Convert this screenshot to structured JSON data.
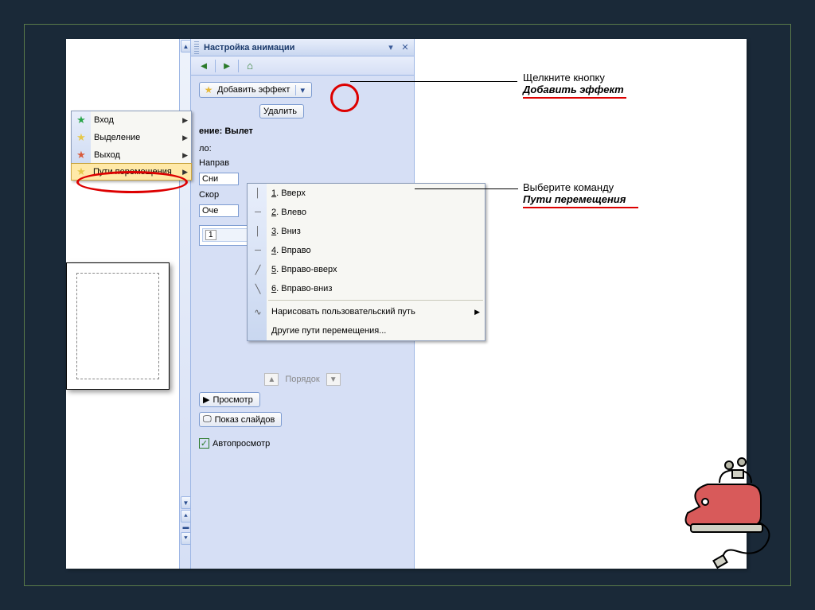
{
  "pane": {
    "title": "Настройка анимации",
    "add_effect": "Добавить эффект",
    "remove": "Удалить",
    "change_label": "ение: Вылет",
    "start_label": "ло:",
    "direction_label": "Направ",
    "direction_value": "Сни",
    "speed_label": "Скор",
    "speed_value": "Оче",
    "item_num": "1",
    "order": "Порядок",
    "preview": "Просмотр",
    "slideshow": "Показ слайдов",
    "autoshow": "Автопросмотр"
  },
  "menu1": {
    "items": [
      {
        "label": "Вход",
        "star_color": "#2aa54a"
      },
      {
        "label": "Выделение",
        "star_color": "#e6c84a"
      },
      {
        "label": "Выход",
        "star_color": "#d85a3a"
      },
      {
        "label": "Пути перемещения",
        "star_color": "#e6c84a",
        "selected": true
      }
    ]
  },
  "menu2": {
    "items": [
      {
        "n": "1",
        "label": "Вверх",
        "icon": "│"
      },
      {
        "n": "2",
        "label": "Влево",
        "icon": "─"
      },
      {
        "n": "3",
        "label": "Вниз",
        "icon": "│"
      },
      {
        "n": "4",
        "label": "Вправо",
        "icon": "─"
      },
      {
        "n": "5",
        "label": "Вправо-вверх",
        "icon": "╱"
      },
      {
        "n": "6",
        "label": "Вправо-вниз",
        "icon": "╲"
      }
    ],
    "custom": "Нарисовать пользовательский путь",
    "more": "Другие пути перемещения..."
  },
  "callouts": {
    "c1a": "Щелкните кнопку",
    "c1b": "Добавить эффект",
    "c2a": "Выберите команду",
    "c2b": "Пути перемещения"
  }
}
